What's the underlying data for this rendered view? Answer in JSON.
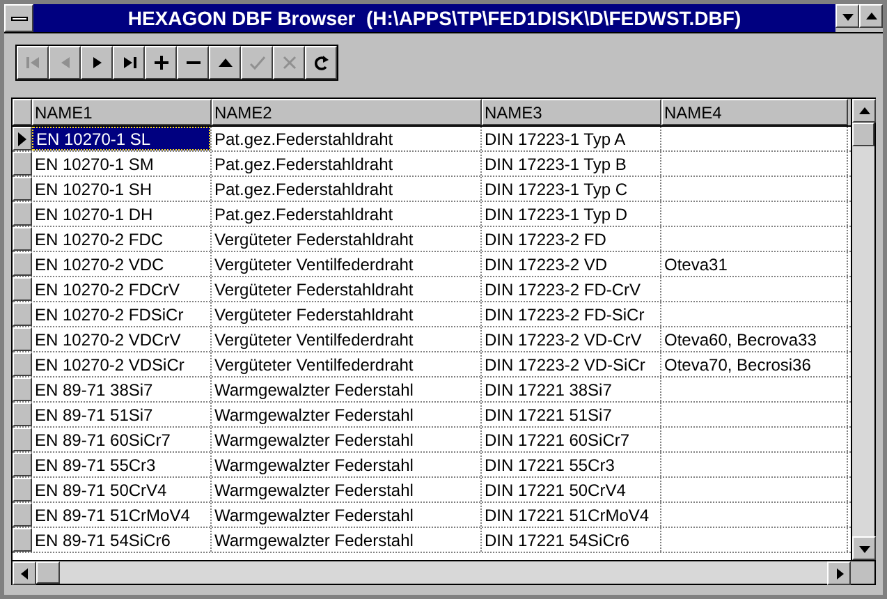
{
  "window": {
    "title": "HEXAGON DBF Browser  (H:\\APPS\\TP\\FED1DISK\\D\\FEDWST.DBF)"
  },
  "toolbar": [
    {
      "kind": "first",
      "disabled": true
    },
    {
      "kind": "prior",
      "disabled": true
    },
    {
      "kind": "next",
      "disabled": false
    },
    {
      "kind": "last",
      "disabled": false
    },
    {
      "kind": "insert",
      "disabled": false
    },
    {
      "kind": "delete",
      "disabled": false
    },
    {
      "kind": "edit",
      "disabled": false
    },
    {
      "kind": "post",
      "disabled": true
    },
    {
      "kind": "cancel",
      "disabled": true
    },
    {
      "kind": "refresh",
      "disabled": false
    }
  ],
  "table": {
    "columns": [
      "NAME1",
      "NAME2",
      "NAME3",
      "NAME4"
    ],
    "rows": [
      {
        "selected": true,
        "cells": [
          "EN 10270-1 SL",
          "Pat.gez.Federstahldraht",
          "DIN 17223-1 Typ A",
          ""
        ]
      },
      {
        "selected": false,
        "cells": [
          "EN 10270-1 SM",
          "Pat.gez.Federstahldraht",
          "DIN 17223-1 Typ B",
          ""
        ]
      },
      {
        "selected": false,
        "cells": [
          "EN 10270-1 SH",
          "Pat.gez.Federstahldraht",
          "DIN 17223-1 Typ C",
          ""
        ]
      },
      {
        "selected": false,
        "cells": [
          "EN 10270-1 DH",
          "Pat.gez.Federstahldraht",
          "DIN 17223-1 Typ D",
          ""
        ]
      },
      {
        "selected": false,
        "cells": [
          "EN 10270-2 FDC",
          "Vergüteter Federstahldraht",
          "DIN 17223-2 FD",
          ""
        ]
      },
      {
        "selected": false,
        "cells": [
          "EN 10270-2 VDC",
          "Vergüteter Ventilfederdraht",
          "DIN 17223-2 VD",
          "Oteva31"
        ]
      },
      {
        "selected": false,
        "cells": [
          "EN 10270-2 FDCrV",
          "Vergüteter Federstahldraht",
          "DIN 17223-2 FD-CrV",
          ""
        ]
      },
      {
        "selected": false,
        "cells": [
          "EN 10270-2 FDSiCr",
          "Vergüteter Federstahldraht",
          "DIN 17223-2 FD-SiCr",
          ""
        ]
      },
      {
        "selected": false,
        "cells": [
          "EN 10270-2 VDCrV",
          "Vergüteter Ventilfederdraht",
          "DIN 17223-2 VD-CrV",
          "Oteva60, Becrova33"
        ]
      },
      {
        "selected": false,
        "cells": [
          "EN 10270-2 VDSiCr",
          "Vergüteter Ventilfederdraht",
          "DIN 17223-2 VD-SiCr",
          "Oteva70, Becrosi36"
        ]
      },
      {
        "selected": false,
        "cells": [
          "EN 89-71 38Si7",
          "Warmgewalzter Federstahl",
          "DIN 17221 38Si7",
          ""
        ]
      },
      {
        "selected": false,
        "cells": [
          "EN 89-71 51Si7",
          "Warmgewalzter Federstahl",
          "DIN 17221 51Si7",
          ""
        ]
      },
      {
        "selected": false,
        "cells": [
          "EN 89-71 60SiCr7",
          "Warmgewalzter Federstahl",
          "DIN 17221 60SiCr7",
          ""
        ]
      },
      {
        "selected": false,
        "cells": [
          "EN 89-71 55Cr3",
          "Warmgewalzter Federstahl",
          "DIN 17221 55Cr3",
          ""
        ]
      },
      {
        "selected": false,
        "cells": [
          "EN 89-71 50CrV4",
          "Warmgewalzter Federstahl",
          "DIN 17221 50CrV4",
          ""
        ]
      },
      {
        "selected": false,
        "cells": [
          "EN 89-71 51CrMoV4",
          "Warmgewalzter Federstahl",
          "DIN 17221 51CrMoV4",
          ""
        ]
      },
      {
        "selected": false,
        "cells": [
          "EN 89-71 54SiCr6",
          "Warmgewalzter Federstahl",
          "DIN 17221 54SiCr6",
          ""
        ]
      }
    ]
  }
}
